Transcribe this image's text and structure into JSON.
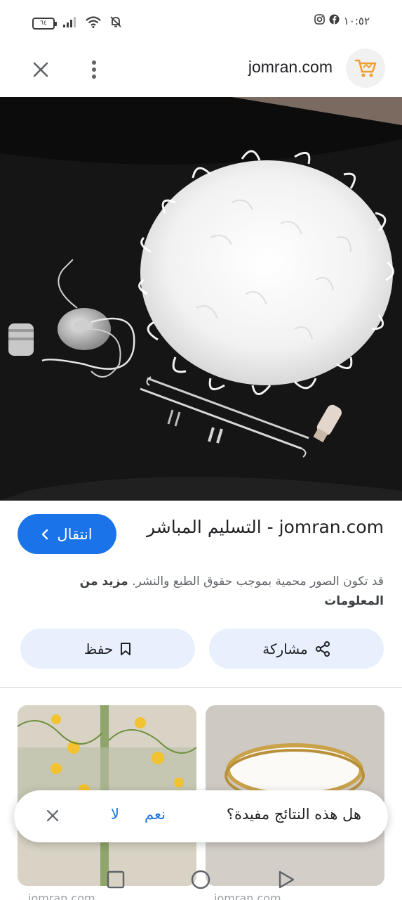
{
  "status_bar": {
    "time": "١٠:٥٢",
    "battery_level": "٦٤"
  },
  "header": {
    "site": "jomran.com"
  },
  "result": {
    "visit_label": "انتقال",
    "title": "jomran.com - التسليم المباشر",
    "copyright_text": "قد تكون الصور محمية بموجب حقوق الطبع والنشر.",
    "more_info_label": "مزيد من المعلومات",
    "share_label": "مشاركة",
    "save_label": "حفظ"
  },
  "related": [
    {
      "caption": "jomran.com"
    },
    {
      "caption": "jomran.com"
    }
  ],
  "feedback": {
    "question": "هل هذه النتائج مفيدة؟",
    "yes_label": "نعم",
    "no_label": "لا"
  },
  "colors": {
    "accent": "#1a73e8",
    "button_tint": "#e8f0fe"
  }
}
